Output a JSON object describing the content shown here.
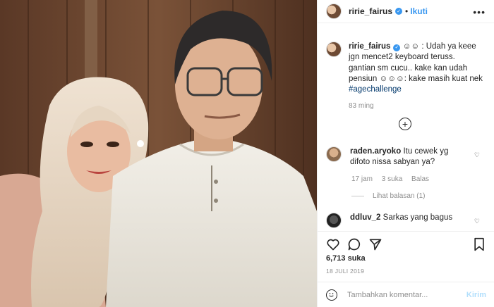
{
  "post": {
    "username": "ririe_fairus",
    "follow_label": "Ikuti",
    "dot": "•",
    "more": "•••"
  },
  "caption": {
    "username": "ririe_fairus",
    "text_1": " ☺☺ : Udah ya keee jgn mencet2 keyboard teruss. gantian sm cucu.. kake kan udah pensiun ☺☺☺: kake masih kuat nek ",
    "hashtag": "#agechallenge",
    "time": "83 ming"
  },
  "comments": [
    {
      "username": "raden.aryoko",
      "text": "Itu cewek yg difoto nissa sabyan ya?",
      "time": "17 jam",
      "likes": "3 suka",
      "reply": "Balas",
      "replies": "Lihat balasan (1)"
    },
    {
      "username": "ddluv_2",
      "text": "Sarkas yang bagus"
    }
  ],
  "stats": {
    "likes": "6,713 suka",
    "date": "18 JULI 2019"
  },
  "add_comment": {
    "placeholder": "Tambahkan komentar...",
    "post_label": "Kirim"
  },
  "icons": {
    "like": "heart-icon",
    "comment": "comment-icon",
    "share": "share-icon",
    "save": "bookmark-icon",
    "emoji": "smile-icon",
    "expand": "plus-circle-icon"
  },
  "colors": {
    "link": "#3897f0",
    "muted": "#8e8e8e",
    "hashtag": "#00376b"
  }
}
